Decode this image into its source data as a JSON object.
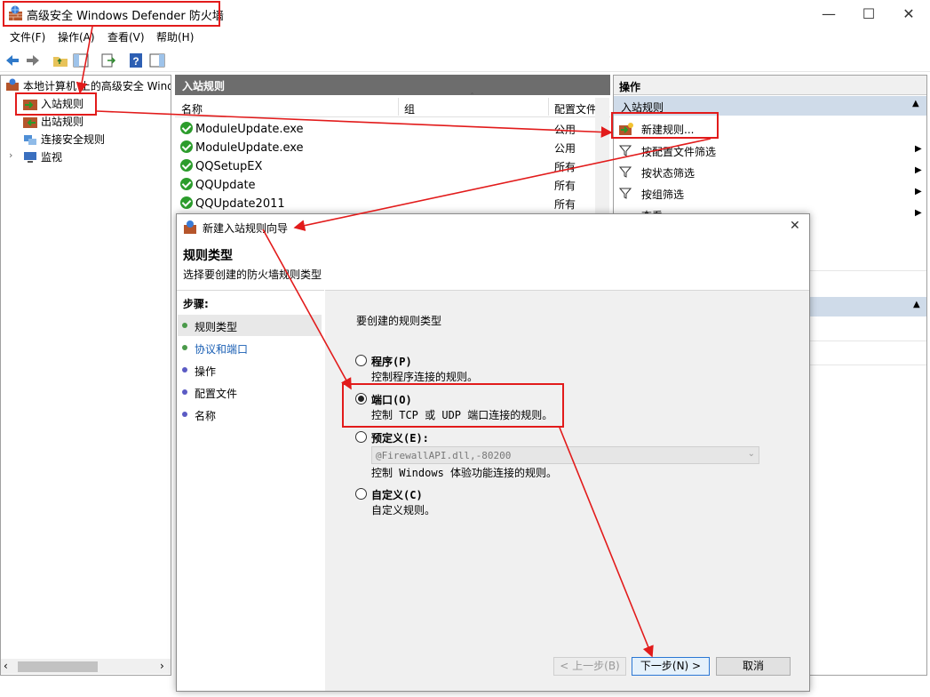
{
  "window": {
    "title": "高级安全 Windows Defender 防火墙"
  },
  "menu": [
    "文件(F)",
    "操作(A)",
    "查看(V)",
    "帮助(H)"
  ],
  "tree": {
    "root": "本地计算机 上的高级安全 Windo",
    "items": [
      "入站规则",
      "出站规则",
      "连接安全规则",
      "监视"
    ]
  },
  "middle": {
    "header": "入站规则",
    "columns": [
      "名称",
      "组",
      "配置文件"
    ],
    "rows": [
      {
        "name": "ModuleUpdate.exe",
        "profile": "公用"
      },
      {
        "name": "ModuleUpdate.exe",
        "profile": "公用"
      },
      {
        "name": "QQSetupEX",
        "profile": "所有"
      },
      {
        "name": "QQUpdate",
        "profile": "所有"
      },
      {
        "name": "QQUpdate2011",
        "profile": "所有"
      }
    ]
  },
  "actions": {
    "header": "操作",
    "section": "入站规则",
    "items": [
      "新建规则...",
      "按配置文件筛选",
      "按状态筛选",
      "按组筛选",
      "查看"
    ]
  },
  "dialog": {
    "title": "新建入站规则向导",
    "heading": "规则类型",
    "subheading": "选择要创建的防火墙规则类型",
    "steps_label": "步骤:",
    "steps": [
      "规则类型",
      "协议和端口",
      "操作",
      "配置文件",
      "名称"
    ],
    "prompt": "要创建的规则类型",
    "options": [
      {
        "label": "程序(P)",
        "desc": "控制程序连接的规则。"
      },
      {
        "label": "端口(O)",
        "desc": "控制 TCP 或 UDP 端口连接的规则。"
      },
      {
        "label": "预定义(E):",
        "desc": "控制 Windows 体验功能连接的规则。"
      },
      {
        "label": "自定义(C)",
        "desc": "自定义规则。"
      }
    ],
    "predefined_value": "@FirewallAPI.dll,-80200",
    "buttons": {
      "back": "< 上一步(B)",
      "next": "下一步(N) >",
      "cancel": "取消"
    }
  },
  "colors": {
    "annotation": "#e21b1b",
    "dark_header": "#6d6d6d",
    "action_section": "#cfdbe9"
  }
}
